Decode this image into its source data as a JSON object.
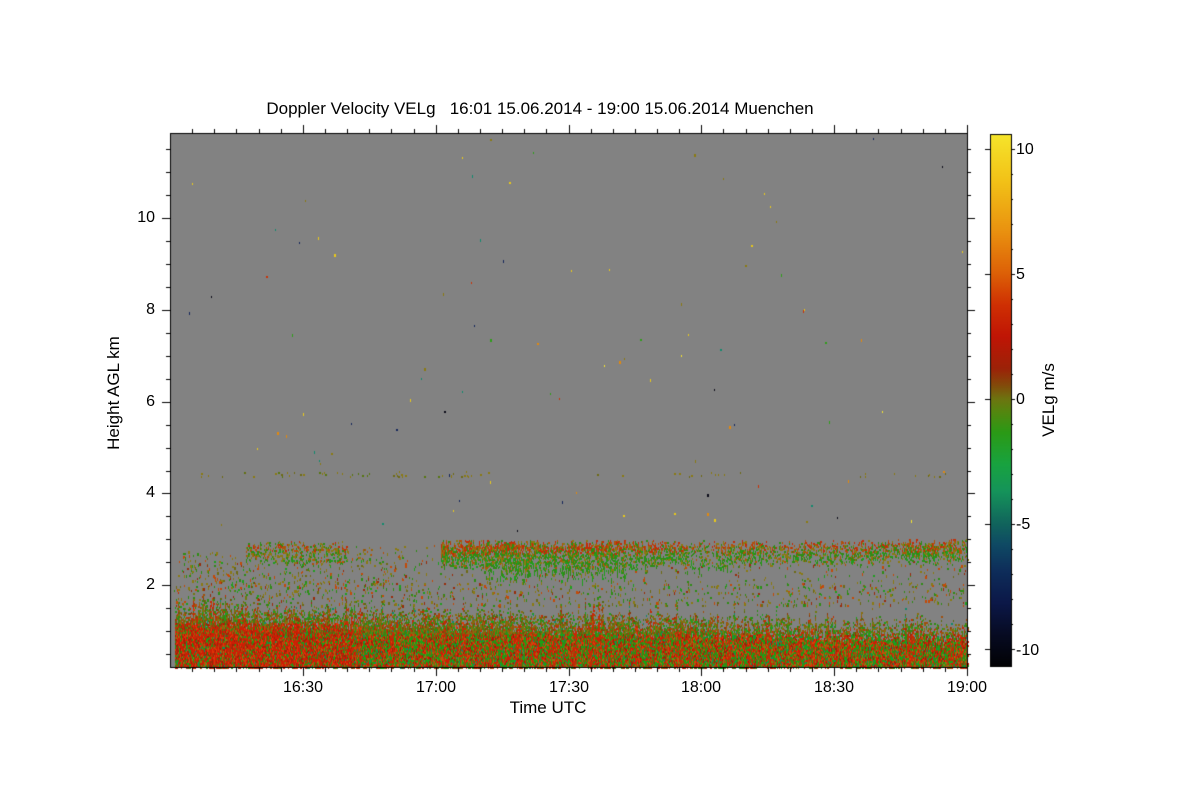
{
  "chart_data": {
    "type": "heatmap",
    "title": "Doppler Velocity VELg   16:01 15.06.2014 - 19:00 15.06.2014 Muenchen",
    "instrument_quantity": "Doppler Velocity VELg",
    "time_start": "16:01 15.06.2014",
    "time_end": "19:00 15.06.2014",
    "station": "Muenchen",
    "xlabel": "Time UTC",
    "ylabel": "Height AGL km",
    "colorbar_label": "VELg m/s",
    "background_color": "#828282",
    "page_background": "#ffffff",
    "seed": 1337,
    "x_axis": {
      "min": 960,
      "max": 1140,
      "major_step": 30,
      "minor_step": 5,
      "labels": [
        "16:30",
        "17:00",
        "17:30",
        "18:00",
        "18:30",
        "19:00"
      ]
    },
    "y_axis": {
      "min": 0.2,
      "max": 11.85,
      "major_ticks": [
        2,
        4,
        6,
        8,
        10
      ],
      "minor_step": 0.5,
      "labels": [
        "10",
        "8",
        "6",
        "4",
        "2"
      ]
    },
    "colorbar": {
      "min": -10.7,
      "max": 10.6,
      "minor_step": 1,
      "major_ticks": [
        10,
        5,
        0,
        -5,
        -10
      ],
      "labels": [
        "10",
        "5",
        "0",
        "-5",
        "-10"
      ],
      "stops": [
        [
          0.0,
          "#020204"
        ],
        [
          0.06,
          "#070b22"
        ],
        [
          0.12,
          "#0c1848"
        ],
        [
          0.18,
          "#0e2d5a"
        ],
        [
          0.23,
          "#0f4a64"
        ],
        [
          0.27,
          "#11655c"
        ],
        [
          0.33,
          "#15945a"
        ],
        [
          0.38,
          "#18a340"
        ],
        [
          0.44,
          "#2b9a16"
        ],
        [
          0.48,
          "#55860f"
        ],
        [
          0.503,
          "#6d7410"
        ],
        [
          0.53,
          "#84480a"
        ],
        [
          0.56,
          "#9c2208"
        ],
        [
          0.62,
          "#c01505"
        ],
        [
          0.68,
          "#cf3003"
        ],
        [
          0.738,
          "#dd6007"
        ],
        [
          0.82,
          "#ea9310"
        ],
        [
          0.91,
          "#f2c117"
        ],
        [
          1.0,
          "#f6e52b"
        ]
      ]
    },
    "layers": [
      {
        "kind": "speckle",
        "t": [
          961,
          1139
        ],
        "h": [
          3.05,
          11.8
        ],
        "count": 92,
        "colors": [
          [
            "#e9c81a",
            26
          ],
          [
            "#e0890f",
            13
          ],
          [
            "#8a7a12",
            13
          ],
          [
            "#15265c",
            12
          ],
          [
            "#0b0b18",
            10
          ],
          [
            "#128a6e",
            8
          ],
          [
            "#2f9e1a",
            8
          ],
          [
            "#c83208",
            6
          ],
          [
            "#f2e230",
            4
          ]
        ]
      },
      {
        "kind": "hline",
        "t": [
          967,
          1032
        ],
        "h": 4.42,
        "jitter": 0.12,
        "count": 50,
        "colors": [
          [
            "#8a7a12",
            62
          ],
          [
            "#6e6a14",
            22
          ],
          [
            "#56760f",
            16
          ]
        ]
      },
      {
        "kind": "hline",
        "t": [
          1056,
          1092
        ],
        "h": 4.42,
        "jitter": 0.1,
        "count": 13,
        "colors": [
          [
            "#8a7a12",
            70
          ],
          [
            "#6e6a14",
            30
          ]
        ]
      },
      {
        "kind": "hline",
        "t": [
          1110,
          1136
        ],
        "h": 4.4,
        "jitter": 0.1,
        "count": 10,
        "colors": [
          [
            "#8a7a12",
            70
          ],
          [
            "#6e6a14",
            30
          ]
        ]
      },
      {
        "kind": "speckle",
        "t": [
          961,
          1140
        ],
        "h": [
          2.0,
          2.6
        ],
        "count": 420,
        "colors": [
          [
            "#8a7a12",
            32
          ],
          [
            "#2f8c14",
            22
          ],
          [
            "#c24a08",
            16
          ],
          [
            "#6e6a14",
            14
          ],
          [
            "#982c0a",
            9
          ],
          [
            "#1fa01f",
            7
          ]
        ]
      },
      {
        "kind": "speckle",
        "t": [
          961,
          1012
        ],
        "h": [
          1.95,
          2.8
        ],
        "count": 240,
        "colors": [
          [
            "#8a7a12",
            30
          ],
          [
            "#2f8c14",
            20
          ],
          [
            "#c24a08",
            20
          ],
          [
            "#6e6a14",
            12
          ],
          [
            "#982c0a",
            10
          ],
          [
            "#1fa01f",
            8
          ]
        ]
      },
      {
        "kind": "speckle",
        "t": [
          961,
          1140
        ],
        "h": [
          1.55,
          2.05
        ],
        "count": 780,
        "colors": [
          [
            "#8a7a12",
            28
          ],
          [
            "#2f8c14",
            26
          ],
          [
            "#c24a08",
            17
          ],
          [
            "#6e6a14",
            12
          ],
          [
            "#982c0a",
            9
          ],
          [
            "#1fa01f",
            8
          ]
        ]
      },
      {
        "kind": "band",
        "t": [
          977,
          1000
        ],
        "h": [
          2.52,
          2.88
        ],
        "density": 0.5,
        "gap": 0.3,
        "top_colors": [
          [
            "#b2500a",
            28
          ],
          [
            "#8a7a12",
            28
          ],
          [
            "#c22c06",
            16
          ],
          [
            "#2f8c14",
            28
          ]
        ],
        "body_colors": [
          [
            "#2f8c14",
            42
          ],
          [
            "#1fa01f",
            18
          ],
          [
            "#8a7a12",
            26
          ],
          [
            "#b2500a",
            14
          ]
        ]
      },
      {
        "kind": "band",
        "t": [
          1002,
          1020
        ],
        "h": [
          2.6,
          2.82
        ],
        "density": 0.18,
        "gap": 0.5,
        "top_colors": [
          [
            "#8a7a12",
            50
          ],
          [
            "#b2500a",
            25
          ],
          [
            "#2f8c14",
            25
          ]
        ],
        "body_colors": [
          [
            "#8a7a12",
            40
          ],
          [
            "#2f8c14",
            40
          ],
          [
            "#b2500a",
            20
          ]
        ]
      },
      {
        "kind": "band",
        "t": [
          1021,
          1071
        ],
        "h": [
          2.42,
          2.9
        ],
        "density": 0.92,
        "gap": 0.05,
        "top_colors": [
          [
            "#c22c06",
            32
          ],
          [
            "#b2500a",
            26
          ],
          [
            "#8a7a12",
            20
          ],
          [
            "#2f8c14",
            22
          ]
        ],
        "body_colors": [
          [
            "#2f8c14",
            44
          ],
          [
            "#1fa01f",
            22
          ],
          [
            "#8a7a12",
            20
          ],
          [
            "#b2500a",
            14
          ]
        ],
        "virga": {
          "t": [
            1031,
            1063
          ],
          "h": 2.05,
          "colors": [
            [
              "#2f8c14",
              58
            ],
            [
              "#1fa01f",
              26
            ],
            [
              "#8a7a12",
              16
            ]
          ]
        }
      },
      {
        "kind": "band",
        "t": [
          1071,
          1121
        ],
        "h": [
          2.5,
          2.9
        ],
        "density": 0.6,
        "gap": 0.22,
        "top_colors": [
          [
            "#c22c06",
            24
          ],
          [
            "#b2500a",
            26
          ],
          [
            "#8a7a12",
            24
          ],
          [
            "#2f8c14",
            26
          ]
        ],
        "body_colors": [
          [
            "#2f8c14",
            46
          ],
          [
            "#1fa01f",
            18
          ],
          [
            "#8a7a12",
            22
          ],
          [
            "#b2500a",
            14
          ]
        ],
        "virga": {
          "t": [
            1076,
            1087
          ],
          "h": 2.28,
          "colors": [
            [
              "#2f8c14",
              60
            ],
            [
              "#1fa01f",
              24
            ],
            [
              "#8a7a12",
              16
            ]
          ]
        }
      },
      {
        "kind": "band",
        "t": [
          1121,
          1140
        ],
        "h": [
          2.55,
          2.92
        ],
        "density": 0.82,
        "gap": 0.1,
        "top_colors": [
          [
            "#b2500a",
            32
          ],
          [
            "#c22c06",
            28
          ],
          [
            "#8a7a12",
            22
          ],
          [
            "#2f8c14",
            18
          ]
        ],
        "body_colors": [
          [
            "#2f8c14",
            40
          ],
          [
            "#1fa01f",
            18
          ],
          [
            "#8a7a12",
            24
          ],
          [
            "#b2500a",
            18
          ]
        ]
      },
      {
        "kind": "bl",
        "t": [
          961,
          1140
        ],
        "top_base": 1.62,
        "top_slope": -0.42,
        "jitter": 0.15,
        "spike_prob": 0.14,
        "spike_amp": 0.38,
        "fade_depth_km": 0.5,
        "deep_h": 0.95,
        "body_colors": [
          [
            "#6f7a10",
            18
          ],
          [
            "#5c6a10",
            10
          ],
          [
            "#8a6e10",
            12
          ],
          [
            "#2f8c14",
            20
          ],
          [
            "#1fa01f",
            8
          ],
          [
            "#a0500c",
            14
          ],
          [
            "#c22c06",
            8
          ],
          [
            "#8a3c0a",
            8
          ],
          [
            "#128a6e",
            2
          ]
        ],
        "deep_colors": [
          [
            "#cc1e04",
            20
          ],
          [
            "#e03408",
            8
          ],
          [
            "#2f8c14",
            20
          ],
          [
            "#17a517",
            16
          ],
          [
            "#a0500c",
            12
          ],
          [
            "#8a7a12",
            10
          ],
          [
            "#992208",
            10
          ],
          [
            "#0f8c60",
            4
          ]
        ],
        "blob": {
          "t": [
            961,
            1001
          ],
          "h": 1.18,
          "boost": 0.5,
          "colors": [
            [
              "#cc1e04",
              55
            ],
            [
              "#e03408",
              20
            ],
            [
              "#a52008",
              15
            ],
            [
              "#8a3c0a",
              10
            ]
          ]
        },
        "streaks": {
          "count": 64,
          "boost": 0.5,
          "colors": [
            [
              "#c82804",
              60
            ],
            [
              "#a0400a",
              25
            ],
            [
              "#e03c08",
              15
            ]
          ]
        }
      }
    ]
  }
}
